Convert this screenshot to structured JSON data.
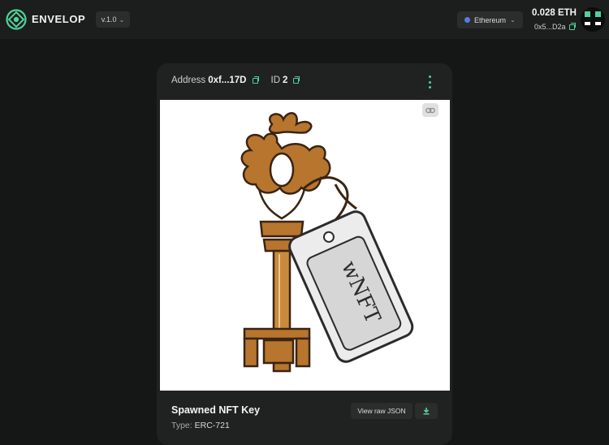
{
  "header": {
    "brand": "ENVELOP",
    "version": "v.1.0",
    "network": "Ethereum",
    "balance": "0.028 ETH",
    "wallet_address": "0x5...D2a"
  },
  "card": {
    "address_label": "Address",
    "address_value": "0xf...17D",
    "id_label": "ID",
    "id_value": "2",
    "image_text": "wNFT",
    "title": "Spawned NFT Key",
    "type_label": "Type:",
    "type_value": "ERC-721",
    "view_json_label": "View raw JSON"
  },
  "colors": {
    "accent": "#4fd29b",
    "background": "#151716",
    "card": "#202221"
  },
  "icons": [
    "envelop-logo-icon",
    "chevron-down-icon",
    "network-dot-icon",
    "copy-icon",
    "avatar-icon",
    "kebab-menu-icon",
    "link-icon",
    "download-icon"
  ]
}
